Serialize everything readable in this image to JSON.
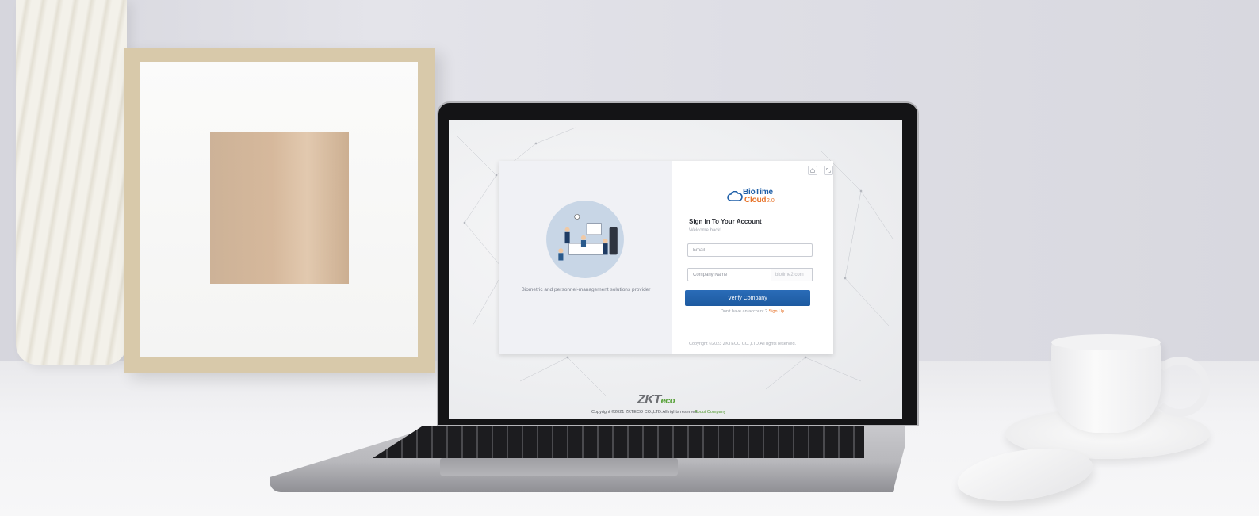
{
  "login": {
    "tagline": "Biometric and personnel-management solutions provider",
    "logo": {
      "brand1": "BioTime",
      "brand2": "Cloud",
      "version": "2.0"
    },
    "title": "Sign In To Your Account",
    "subtitle": "Welcome back!",
    "email_placeholder": "Email",
    "company_placeholder": "Company Name",
    "company_suffix": "biotime2.com",
    "verify_label": "Verify Company",
    "signup_prompt": "Don't have an account ?",
    "signup_link": "Sign Up",
    "card_copyright": "Copyright ©2023 ZKTECO CO.,LTD.All rights reserved."
  },
  "footer": {
    "logo_main": "ZKT",
    "logo_accent": "eco",
    "copyright": "Copyright ©2021 ZKTECO CO.,LTD.All rights reserved",
    "about_link": "About Company"
  },
  "colors": {
    "primary": "#1e5fa8",
    "accent": "#e7742b",
    "footer_link": "#4f9a2e"
  },
  "icons": [
    "home-icon",
    "expand-icon",
    "cloud-logo-icon"
  ]
}
